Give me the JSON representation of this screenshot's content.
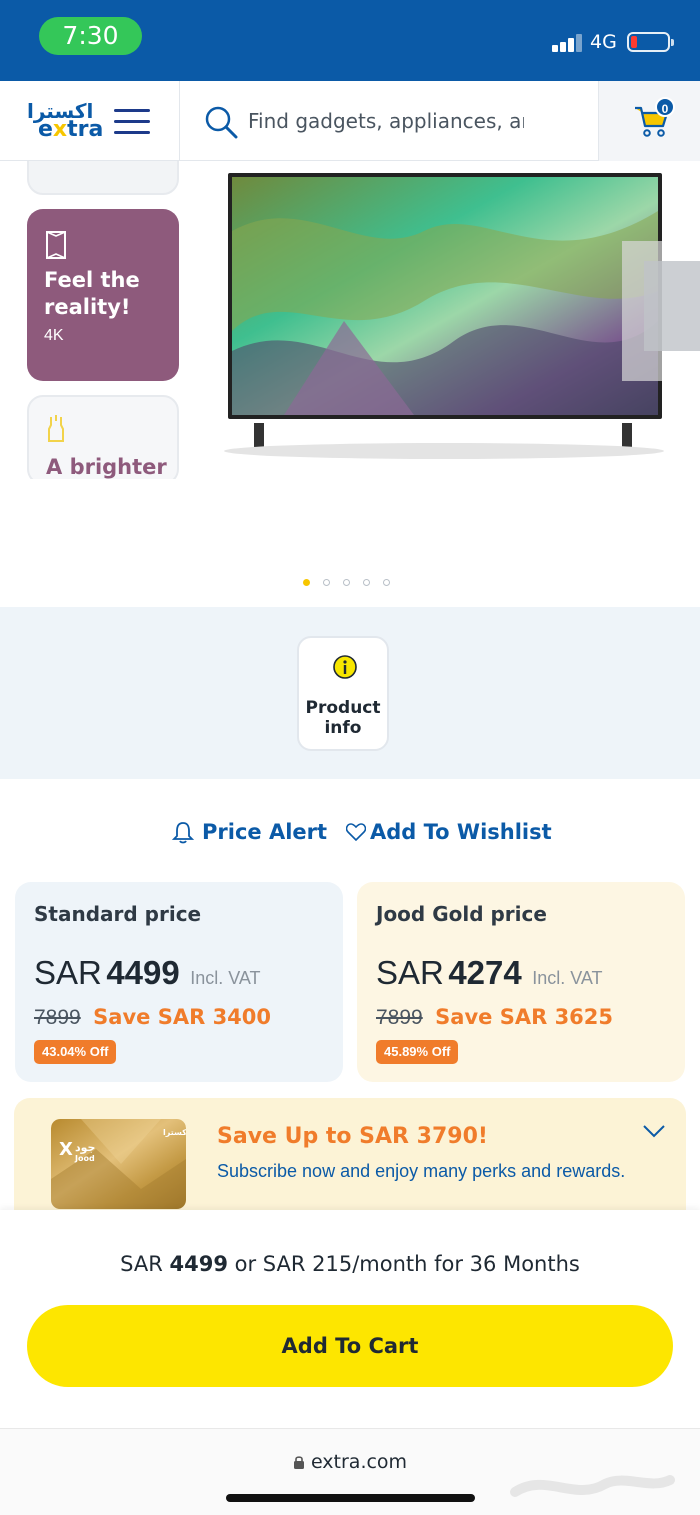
{
  "status_bar": {
    "time": "7:30",
    "network": "4G",
    "signal_bars": 4,
    "battery_level": 0.15,
    "colors": {
      "bar_bg": "#0b5aa7",
      "time_pill": "#34c759",
      "battery_low": "#ff3b30"
    }
  },
  "header": {
    "logo_arabic": "اكسترا",
    "logo_brand_prefix": "e",
    "logo_brand_accent": "x",
    "logo_brand_suffix": "tra",
    "search_placeholder": "Find gadgets, appliances, and i",
    "cart_count": "0",
    "menu_icon": "hamburger-icon",
    "search_icon": "search-icon",
    "cart_icon": "cart-icon"
  },
  "gallery": {
    "feature_card": {
      "title": "Feel the reality!",
      "subtitle": "4K",
      "icon": "tv-frame-icon"
    },
    "feature_card_2": {
      "title": "A brighter",
      "icon": "bulb-icon"
    },
    "active_slide": 1,
    "slide_count": 5
  },
  "product_info": {
    "label": "Product info",
    "icon": "info-icon"
  },
  "actions": {
    "price_alert": "Price Alert",
    "wishlist": "Add To Wishlist"
  },
  "prices": {
    "standard": {
      "heading": "Standard price",
      "currency": "SAR",
      "amount": "4499",
      "vat": "Incl. VAT",
      "old_price": "7899",
      "save": "Save SAR 3400",
      "off": "43.04% Off"
    },
    "gold": {
      "heading": "Jood Gold price",
      "currency": "SAR",
      "amount": "4274",
      "vat": "Incl. VAT",
      "old_price": "7899",
      "save": "Save SAR 3625",
      "off": "45.89% Off"
    }
  },
  "jood": {
    "card_brand_ar": "جود",
    "card_brand_en": "Jood",
    "title": "Save Up to SAR 3790!",
    "description": "Subscribe now and enjoy many perks and rewards."
  },
  "bottom": {
    "installment_prefix": "SAR ",
    "installment_amount": "4499",
    "installment_suffix": " or SAR 215/month for 36 Months",
    "add_to_cart": "Add To Cart"
  },
  "browser": {
    "url": "extra.com"
  },
  "colors": {
    "brand_blue": "#0b5aa7",
    "brand_yellow": "#fde600",
    "accent_orange": "#f07c2b",
    "feature_purple": "#8e5a7c"
  }
}
